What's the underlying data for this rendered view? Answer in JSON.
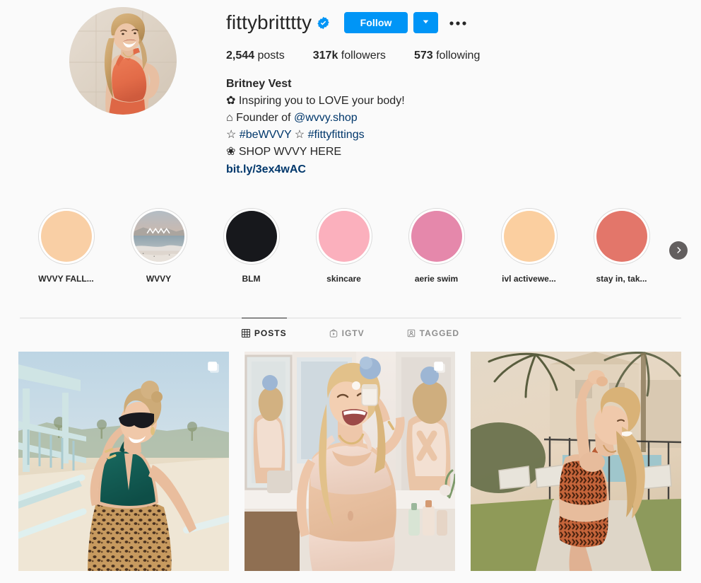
{
  "profile": {
    "username": "fittybritttty",
    "verified": true,
    "verified_icon": "verified-badge-icon",
    "follow_label": "Follow",
    "dropdown_icon": "chevron-down-icon",
    "more_options_icon": "ellipsis-icon",
    "stats": [
      {
        "number": "2,544",
        "label": "posts"
      },
      {
        "number": "317k",
        "label": "followers"
      },
      {
        "number": "573",
        "label": "following"
      }
    ],
    "bio": {
      "full_name": "Britney Vest",
      "lines": [
        {
          "emoji": "✿",
          "text": " Inspiring you to LOVE your body!"
        },
        {
          "emoji": "⌂",
          "text": " Founder of ",
          "mention": "@wvvy.shop"
        },
        {
          "emoji": "☆",
          "text": " ",
          "tag1": "#beWVVY",
          "mid": " ☆ ",
          "tag2": "#fittyfittings"
        },
        {
          "emoji": "❀",
          "text": " SHOP WVVY HERE"
        }
      ],
      "url": "bit.ly/3ex4wAC"
    }
  },
  "highlights": {
    "next_icon": "chevron-right-icon",
    "items": [
      {
        "label": "WVVY FALL...",
        "color": "#f9cfa5",
        "type": "solid"
      },
      {
        "label": "WVVY",
        "color": "#a9b6c0",
        "type": "beach"
      },
      {
        "label": "BLM",
        "color": "#17181c",
        "type": "solid"
      },
      {
        "label": "skincare",
        "color": "#fbb0bd",
        "type": "solid"
      },
      {
        "label": "aerie swim",
        "color": "#e588ab",
        "type": "solid"
      },
      {
        "label": "ivl activewe...",
        "color": "#fbcfa0",
        "type": "solid"
      },
      {
        "label": "stay in, tak...",
        "color": "#e3766a",
        "type": "solid"
      }
    ]
  },
  "tabs": [
    {
      "label": "POSTS",
      "icon": "grid-icon",
      "active": true
    },
    {
      "label": "IGTV",
      "icon": "igtv-icon",
      "active": false
    },
    {
      "label": "TAGGED",
      "icon": "tagged-person-icon",
      "active": false
    }
  ],
  "posts": [
    {
      "description": "Woman in teal swimsuit and leopard skirt at beach lifeguard tower",
      "is_carousel": true,
      "carousel_icon": "carousel-multi-photo-icon"
    },
    {
      "description": "Woman laughing in blush underwear set in bathroom with mirror",
      "is_carousel": true,
      "carousel_icon": "carousel-multi-photo-icon"
    },
    {
      "description": "Woman in orange patterned bikini outdoors by pool with palm trees",
      "is_carousel": false,
      "carousel_icon": ""
    }
  ],
  "colors": {
    "accent": "#0095f6",
    "link": "#00376b",
    "text": "#262626",
    "muted": "#8e8e8e",
    "border": "#dbdbdb",
    "background": "#fafafa"
  }
}
